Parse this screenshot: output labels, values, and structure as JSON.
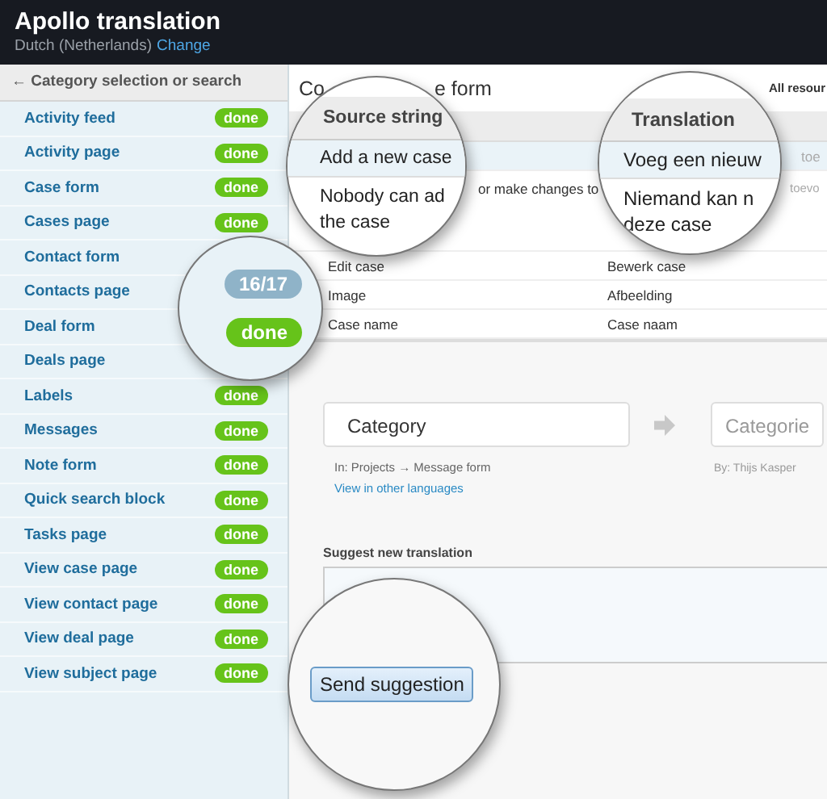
{
  "header": {
    "title": "Apollo translation",
    "language": "Dutch (Netherlands)",
    "change_link": "Change"
  },
  "sidebar": {
    "back": "← Category selection or search",
    "items": [
      {
        "label": "Activity feed",
        "badge": "done",
        "kind": "done",
        "magnified": false
      },
      {
        "label": "Activity page",
        "badge": "done",
        "kind": "done",
        "magnified": false
      },
      {
        "label": "Case form",
        "badge": "done",
        "kind": "done",
        "magnified": false
      },
      {
        "label": "Cases page",
        "badge": "done",
        "kind": "done",
        "magnified": false
      },
      {
        "label": "Contact form"
      },
      {
        "label": "Contacts page",
        "badge": "16/17",
        "kind": "partial",
        "magnified": true
      },
      {
        "label": "Deal form",
        "badge": "done",
        "kind": "done",
        "magnified": true
      },
      {
        "label": "Deals page"
      },
      {
        "label": "Labels",
        "badge": "done",
        "kind": "done",
        "magnified": false
      },
      {
        "label": "Messages",
        "badge": "done",
        "kind": "done",
        "magnified": false
      },
      {
        "label": "Note form",
        "badge": "done",
        "kind": "done",
        "magnified": false
      },
      {
        "label": "Quick search block",
        "badge": "done",
        "kind": "done",
        "magnified": false
      },
      {
        "label": "Tasks page",
        "badge": "done",
        "kind": "done",
        "magnified": false
      },
      {
        "label": "View case page",
        "badge": "done",
        "kind": "done",
        "magnified": false
      },
      {
        "label": "View contact page",
        "badge": "done",
        "kind": "done",
        "magnified": false
      },
      {
        "label": "View deal page",
        "badge": "done",
        "kind": "done",
        "magnified": false
      },
      {
        "label": "View subject page",
        "badge": "done",
        "kind": "done",
        "magnified": false
      }
    ]
  },
  "main": {
    "title_start": "Co",
    "title_end": "e form",
    "resources_link": "All resour",
    "table": {
      "rows": [
        {
          "translation": "toe"
        },
        {
          "source": "or make changes to",
          "translation": "toevo"
        },
        {
          "source": "Edit case",
          "translation": "Bewerk case"
        },
        {
          "source": "Image",
          "translation": "Afbeelding"
        },
        {
          "source": "Case name",
          "translation": "Case naam"
        }
      ]
    },
    "editor": {
      "source_value": "Category",
      "target_value": "Categorie",
      "path": "In: Projects → Message form",
      "other_languages_link": "View in other languages",
      "author": "By: Thijs Kasper",
      "suggest_label": "Suggest new translation"
    }
  },
  "magnifiers": {
    "source": {
      "header": "Source string",
      "lines": [
        "Add a new case",
        "Nobody can ad",
        "the case"
      ]
    },
    "translation": {
      "header": "Translation",
      "lines": [
        "Voeg een nieuw",
        "Niemand kan n",
        "deze case"
      ]
    },
    "button": {
      "label": "Send suggestion"
    }
  }
}
